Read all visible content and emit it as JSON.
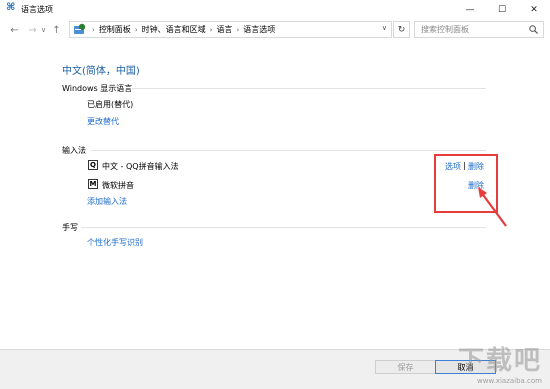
{
  "window": {
    "title": "语言选项",
    "controls": [
      "—",
      "☐",
      "✕"
    ]
  },
  "nav": {
    "back": "←",
    "forward": "→",
    "recent": "∨",
    "up": "↑",
    "breadcrumbs": [
      "控制面板",
      "时钟、语言和区域",
      "语言",
      "语言选项"
    ],
    "refresh": "↻",
    "search_placeholder": "搜索控制面板",
    "search_icon": "search-icon"
  },
  "content": {
    "language_heading": "中文(简体，中国)",
    "display_section": {
      "label": "Windows 显示语言",
      "status": "已启用(替代)",
      "link": "更改替代"
    },
    "input_section": {
      "label": "输入法",
      "methods": [
        {
          "icon": "Q",
          "name": "中文 - QQ拼音输入法",
          "options": "选项",
          "separator": "|",
          "remove": "删除"
        },
        {
          "icon": "M",
          "name": "微软拼音",
          "remove": "删除"
        }
      ],
      "add_link": "添加输入法"
    },
    "handwriting_section": {
      "label": "手写",
      "link": "个性化手写识别"
    }
  },
  "annotation": {
    "color": "#e53c3c"
  },
  "footer": {
    "save": "保存",
    "cancel": "取消"
  },
  "watermark": {
    "big": "下载吧",
    "small": "www.xiazaiba.com"
  },
  "colors": {
    "link": "#1b6ac9",
    "heading": "#1b5fa8",
    "highlight": "#e53c3c"
  }
}
